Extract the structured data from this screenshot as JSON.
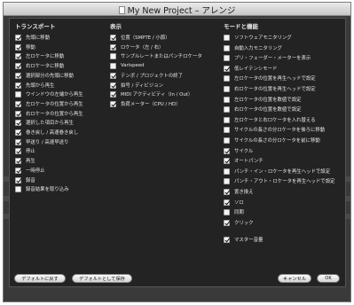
{
  "window": {
    "title": "My New Project – アレンジ"
  },
  "columns": [
    {
      "header": "トランスポート",
      "items": [
        {
          "label": "先頭に移動",
          "checked": true
        },
        {
          "label": "移動",
          "checked": true
        },
        {
          "label": "左ロケータに移動",
          "checked": true
        },
        {
          "label": "右ロケータに移動",
          "checked": true
        },
        {
          "label": "選択部分の先頭に移動",
          "checked": true
        },
        {
          "label": "先頭から再生",
          "checked": true
        },
        {
          "label": "ウインドウの左端から再生",
          "checked": false
        },
        {
          "label": "左ロケータの位置から再生",
          "checked": true
        },
        {
          "label": "右ロケータの位置から再生",
          "checked": true
        },
        {
          "label": "選択した項目から再生",
          "checked": true
        },
        {
          "label": "巻き戻し / 高速巻き戻し",
          "checked": true
        },
        {
          "label": "早送り / 高速早送り",
          "checked": true
        },
        {
          "label": "停止",
          "checked": true
        },
        {
          "label": "再生",
          "checked": true
        },
        {
          "label": "一時停止",
          "checked": true
        },
        {
          "label": "録音",
          "checked": true
        },
        {
          "label": "録音結果を取り込み",
          "checked": false
        }
      ]
    },
    {
      "header": "表示",
      "items": [
        {
          "label": "位置（SMPTE / 小節）",
          "checked": true
        },
        {
          "label": "ロケータ（左 / 右）",
          "checked": true
        },
        {
          "label": "サンプルレートまたはパンチロケータ",
          "checked": false
        },
        {
          "label": "Varispeed",
          "checked": false
        },
        {
          "label": "テンポ / プロジェクトの終了",
          "checked": true
        },
        {
          "label": "拍号 / ディビジョン",
          "checked": true
        },
        {
          "label": "MIDI アクティビティ（In / Out）",
          "checked": true
        },
        {
          "label": "負荷メーター（CPU / HD）",
          "checked": true
        }
      ]
    },
    {
      "header": "モードと機能",
      "items": [
        {
          "label": "ソフトウェアモニタリング",
          "checked": false
        },
        {
          "label": "自動入力モニタリング",
          "checked": false
        },
        {
          "label": "プリ・フェーダー・メーターを表示",
          "checked": false
        },
        {
          "label": "低レイテンシモード",
          "checked": true
        },
        {
          "label": "左ロケータの位置を再生ヘッドで設定",
          "checked": false
        },
        {
          "label": "右ロケータの位置を再生ヘッドで設定",
          "checked": false
        },
        {
          "label": "左ロケータの位置を数値で設定",
          "checked": false
        },
        {
          "label": "右ロケータの位置を数値で設定",
          "checked": false
        },
        {
          "label": "左ロケータと右ロケータを入れ替える",
          "checked": false
        },
        {
          "label": "サイクルの長さの分ロケータを後ろに移動",
          "checked": false
        },
        {
          "label": "サイクルの長さの分ロケータを前に移動",
          "checked": false
        },
        {
          "label": "サイクル",
          "checked": true
        },
        {
          "label": "オートパンチ",
          "checked": true
        },
        {
          "label": "パンチ・イン・ロケータを再生ヘッドで設定",
          "checked": false
        },
        {
          "label": "パンチ・アウト・ロケータを再生ヘッドで設定",
          "checked": false
        },
        {
          "label": "置き換え",
          "checked": true
        },
        {
          "label": "ソロ",
          "checked": true
        },
        {
          "label": "同期",
          "checked": false
        },
        {
          "label": "クリック",
          "checked": true
        },
        {
          "label": "マスター音量",
          "checked": true
        }
      ]
    }
  ],
  "buttons": {
    "restore_default": "デフォルトに戻す",
    "save_default": "デフォルトとして保存",
    "cancel": "キャンセル",
    "ok": "OK"
  }
}
